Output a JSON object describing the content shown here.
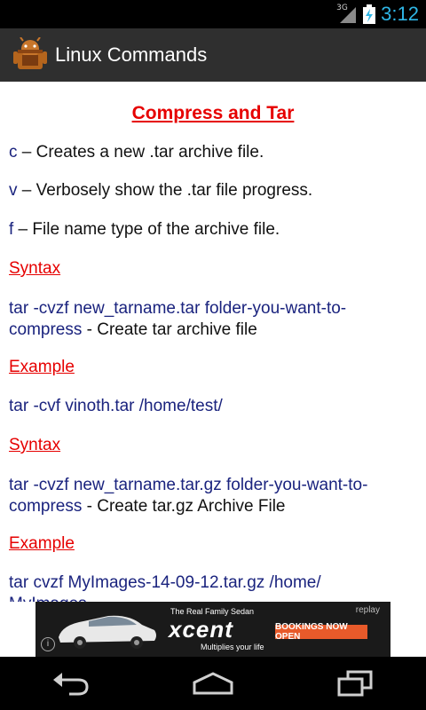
{
  "status_bar": {
    "network": "3G",
    "time": "3:12",
    "icons": [
      "3g-signal-icon",
      "battery-charging-icon"
    ]
  },
  "action_bar": {
    "title": "Linux Commands",
    "icon": "android-app-icon"
  },
  "content": {
    "heading": "Compress and Tar",
    "options": [
      {
        "flag": "c",
        "text": " – Creates a new .tar archive file."
      },
      {
        "flag": "v",
        "text": " – Verbosely show the .tar file progress."
      },
      {
        "flag": "f",
        "text": " – File name type of the archive file."
      }
    ],
    "sections": [
      {
        "syntax_label": "Syntax",
        "syntax_command_line1": "tar -cvzf new_tarname.tar folder-you-want-to-",
        "syntax_command_line2": "compress",
        "syntax_desc": " - Create tar archive file",
        "example_label": "Example",
        "example_command": "tar -cvf vinoth.tar /home/test/"
      },
      {
        "syntax_label": "Syntax",
        "syntax_command_line1": "tar -cvzf new_tarname.tar.gz folder-you-want-to-",
        "syntax_command_line2": "compress",
        "syntax_desc": " - Create tar.gz Archive File",
        "example_label": "Example",
        "example_command": "tar cvzf MyImages-14-09-12.tar.gz /home/",
        "example_command_cont": "MyImages"
      }
    ]
  },
  "ad": {
    "tagline": "The Real Family Sedan",
    "brand": "xcent",
    "subtag": "Multiplies your life",
    "cta": "BOOKINGS NOW OPEN",
    "replay": "replay",
    "info": "i"
  },
  "colors": {
    "heading_red": "#e60000",
    "command_navy": "#1a237e",
    "clock_blue": "#2fb6e6",
    "actionbar_bg": "#2f2f2f"
  },
  "nav_bar": {
    "buttons": [
      "back-icon",
      "home-icon",
      "recent-apps-icon"
    ]
  }
}
